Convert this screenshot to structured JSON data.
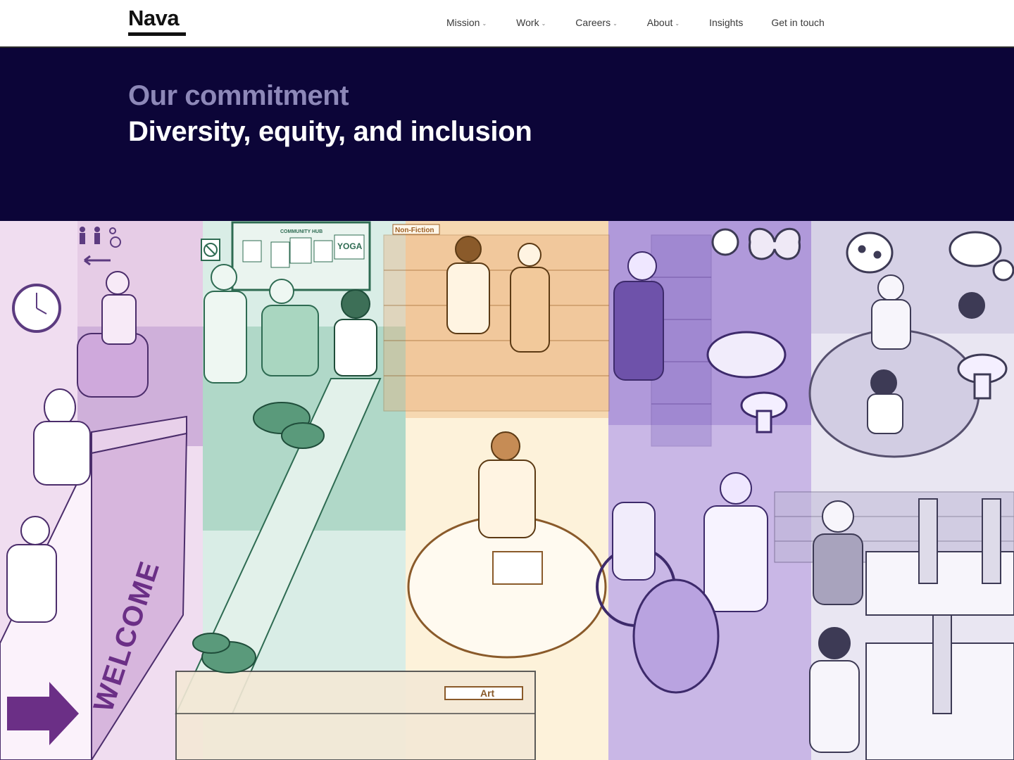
{
  "brand": {
    "name": "Nava"
  },
  "nav": {
    "items": [
      {
        "label": "Mission",
        "has_dropdown": true
      },
      {
        "label": "Work",
        "has_dropdown": true
      },
      {
        "label": "Careers",
        "has_dropdown": true
      },
      {
        "label": "About",
        "has_dropdown": true
      },
      {
        "label": "Insights",
        "has_dropdown": false
      },
      {
        "label": "Get in touch",
        "has_dropdown": false
      }
    ]
  },
  "hero": {
    "eyebrow": "Our commitment",
    "title": "Diversity, equity, and inclusion"
  },
  "illustration": {
    "signs": {
      "community_hub": "COMMUNITY HUB",
      "yoga": "YOGA",
      "non_fiction": "Non-Fiction",
      "art": "Art",
      "welcome": "WELCOME"
    }
  },
  "colors": {
    "header_bg": "#ffffff",
    "hero_bg": "#0c0538",
    "eyebrow": "#8d88b8",
    "title": "#ffffff",
    "band_pink": "#f0ddf0",
    "band_green": "#d9ede6",
    "band_cream": "#fdf2da",
    "band_purple": "#c9b7e6",
    "band_lavender": "#e9e6f2"
  }
}
